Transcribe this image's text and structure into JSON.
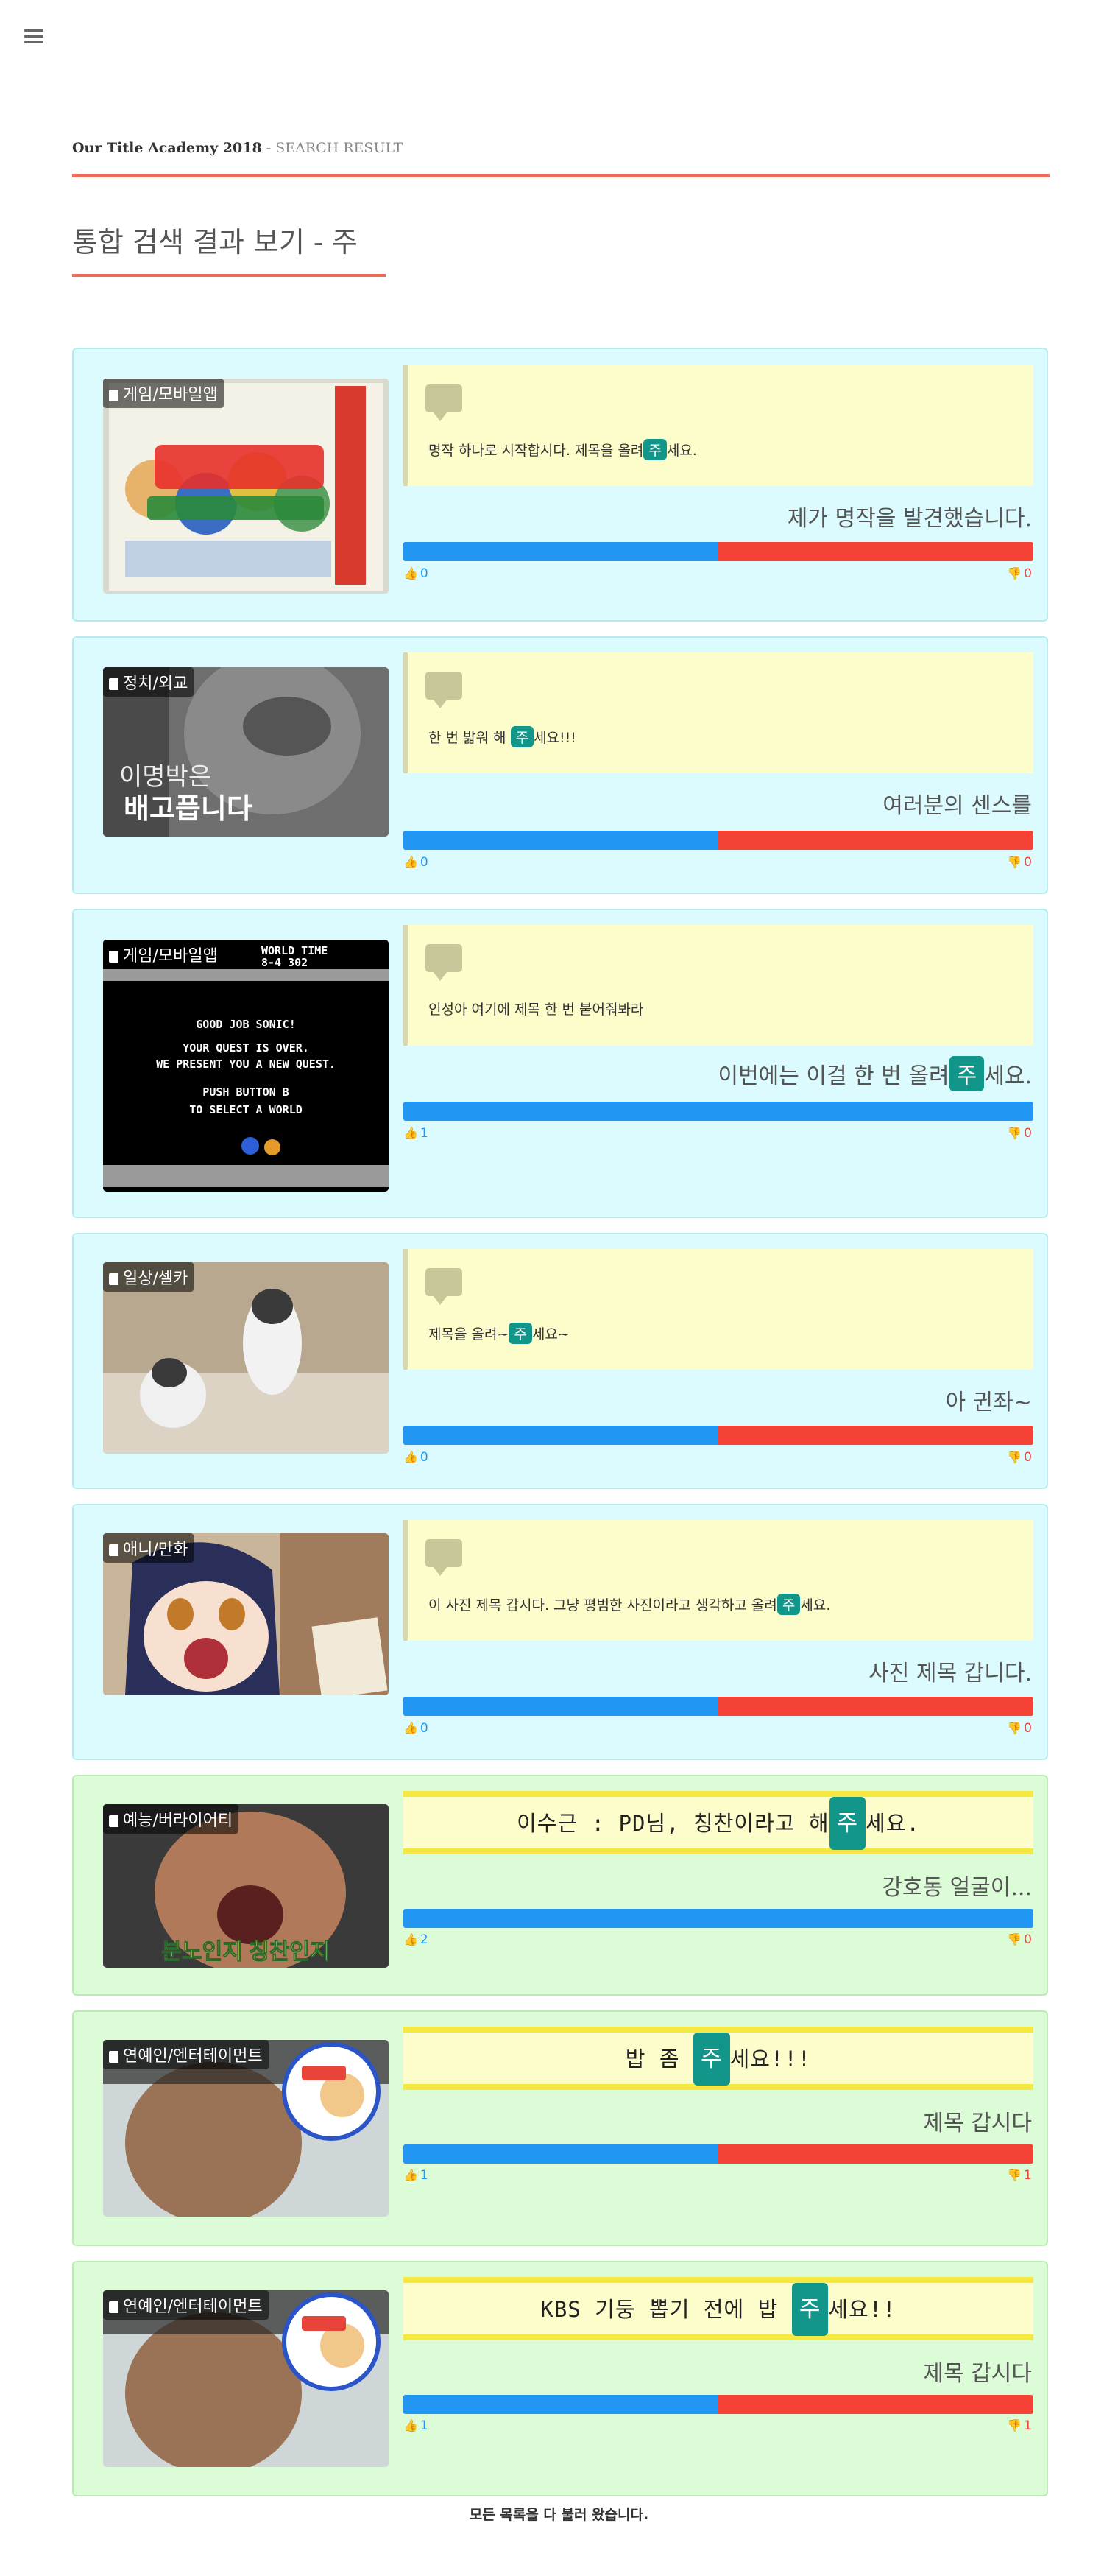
{
  "header": {
    "brand": "Our Title Academy 2018",
    "separator": " - ",
    "section": "SEARCH RESULT",
    "page_title": "통합 검색 결과 보기 - 주"
  },
  "results": [
    {
      "category": "게임/모바일앱",
      "quote_before": "명작 하나로 시작합시다. 제목을 올려",
      "quote_highlight": "주",
      "quote_after": "세요.",
      "answer_before": "제가 명작을 발견했습니다.",
      "answer_highlight": "",
      "answer_after": "",
      "likes": "0",
      "dislikes": "0",
      "like_ratio": 0.5
    },
    {
      "category": "정치/외교",
      "quote_before": "한 번 밟워 해",
      "quote_highlight": "주",
      "quote_after": "세요!!!",
      "answer_before": "여러분의 센스를",
      "answer_highlight": "",
      "answer_after": "",
      "likes": "0",
      "dislikes": "0",
      "like_ratio": 0.5,
      "image_caption_1": "이명박은",
      "image_caption_2": "배고픕니다"
    },
    {
      "category": "게임/모바일앱",
      "quote_before": "인성아 여기에 제목 한 번 붙어줘봐라",
      "quote_highlight": "",
      "quote_after": "",
      "answer_before": "이번에는 이걸 한 번 올려",
      "answer_highlight": "주",
      "answer_after": "세요.",
      "likes": "1",
      "dislikes": "0",
      "like_ratio": 1.0,
      "image_lines": [
        "WORLD   TIME",
        "8-4    302",
        "GOOD  JOB SONIC!",
        "YOUR QUEST IS OVER.",
        "WE PRESENT YOU A NEW QUEST.",
        "PUSH BUTTON B",
        "TO SELECT A WORLD"
      ]
    },
    {
      "category": "일상/셀카",
      "quote_before": "제목을 올려~",
      "quote_highlight": "주",
      "quote_after": "세요~",
      "answer_before": "아 귄좌~",
      "answer_highlight": "",
      "answer_after": "",
      "likes": "0",
      "dislikes": "0",
      "like_ratio": 0.5
    },
    {
      "category": "애니/만화",
      "quote_before": "이 사진 제목 갑시다. 그냥 평범한 사진이라고 생각하고 올려",
      "quote_highlight": "주",
      "quote_after": "세요.",
      "answer_before": "사진 제목 갑니다.",
      "answer_highlight": "",
      "answer_after": "",
      "likes": "0",
      "dislikes": "0",
      "like_ratio": 0.5
    },
    {
      "category": "예능/버라이어티",
      "banner_before": "이수근 : PD님, 칭찬이라고 해",
      "banner_highlight": "주",
      "banner_after": "세요.",
      "answer_before": "강호동 얼굴이...",
      "answer_highlight": "",
      "answer_after": "",
      "likes": "2",
      "dislikes": "0",
      "like_ratio": 1.0,
      "image_caption_1": "분노인지 칭찬인지"
    },
    {
      "category": "연예인/엔터테이먼트",
      "banner_before": "밥 좀",
      "banner_highlight": "주",
      "banner_after": "세요!!!",
      "answer_before": "제목 갑시다",
      "answer_highlight": "",
      "answer_after": "",
      "likes": "1",
      "dislikes": "1",
      "like_ratio": 0.5
    },
    {
      "category": "연예인/엔터테이먼트",
      "banner_before": "KBS 기둥 뽑기 전에 밥",
      "banner_highlight": "주",
      "banner_after": "세요!!",
      "answer_before": "제목 갑시다",
      "answer_highlight": "",
      "answer_after": "",
      "likes": "1",
      "dislikes": "1",
      "like_ratio": 0.5
    }
  ],
  "footer": {
    "text": "모든 목록을 다 불러 왔습니다."
  },
  "colors": {
    "accent_line": "#ef6a5a",
    "highlight": "#13968a",
    "like": "#2196f3",
    "dislike": "#f44336",
    "card_blue": "#dcfbfe",
    "card_green": "#dcfcd8",
    "quote_bg": "#fdfccb"
  }
}
